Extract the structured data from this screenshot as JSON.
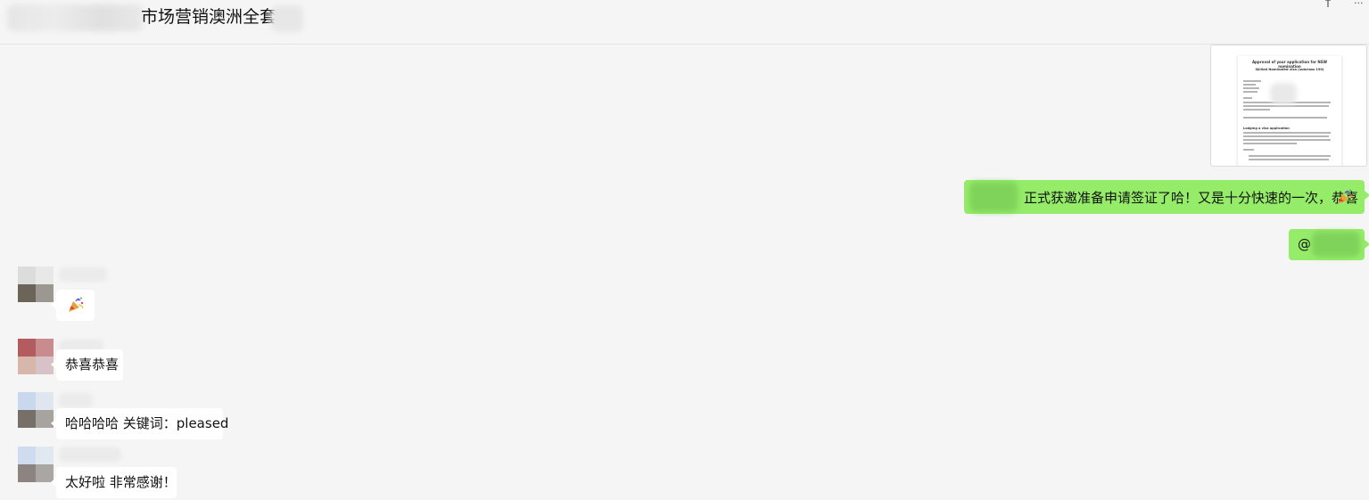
{
  "header": {
    "title": "市场营销澳洲全套"
  },
  "icons": {
    "pin": "pin-icon",
    "more": "more-icon",
    "party": "party-popper-icon"
  },
  "colors": {
    "self_bubble": "#95ec69",
    "other_bubble": "#ffffff",
    "background": "#f5f5f5"
  },
  "image_message": {
    "doc_title": "Approval of your application for NSW nomination",
    "doc_subtitle": "Skilled Nominated visa (subclass 190)",
    "doc_heading": "Lodging a visa application"
  },
  "messages_self": [
    {
      "text": "正式获邀准备申请签证了哈！又是十分快速的一次，恭喜"
    },
    {
      "text": "@"
    }
  ],
  "messages_other": [
    {
      "text": ""
    },
    {
      "text": "恭喜恭喜"
    },
    {
      "text": "哈哈哈哈 关键词：pleased"
    },
    {
      "text": "太好啦 非常感谢！"
    }
  ]
}
